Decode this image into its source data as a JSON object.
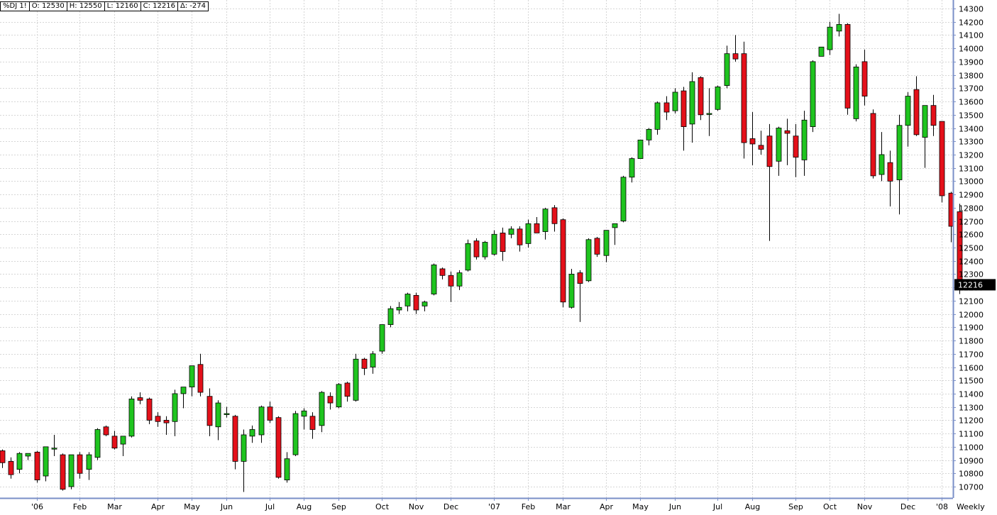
{
  "header": {
    "symbol": "%DJ 1!",
    "open": "O: 12530",
    "high": "H: 12550",
    "low": "L: 12160",
    "close": "C: 12216",
    "change": "Δ: -274"
  },
  "chart_data": {
    "type": "candlestick",
    "interval_label": "Weekly",
    "last_value_label": "12216",
    "ylim": [
      10630,
      14320
    ],
    "yticks": [
      10700,
      10800,
      10900,
      11000,
      11100,
      11200,
      11300,
      11400,
      11500,
      11600,
      11700,
      11800,
      11900,
      12000,
      12100,
      12200,
      12300,
      12400,
      12500,
      12600,
      12700,
      12800,
      12900,
      13000,
      13100,
      13200,
      13300,
      13400,
      13500,
      13600,
      13700,
      13800,
      13900,
      14000,
      14100,
      14200,
      14300
    ],
    "x_labels": [
      {
        "index": 4,
        "label": "'06"
      },
      {
        "index": 9,
        "label": "Feb"
      },
      {
        "index": 13,
        "label": "Mar"
      },
      {
        "index": 18,
        "label": "Apr"
      },
      {
        "index": 22,
        "label": "May"
      },
      {
        "index": 26,
        "label": "Jun"
      },
      {
        "index": 31,
        "label": "Jul"
      },
      {
        "index": 35,
        "label": "Aug"
      },
      {
        "index": 39,
        "label": "Sep"
      },
      {
        "index": 44,
        "label": "Oct"
      },
      {
        "index": 48,
        "label": "Nov"
      },
      {
        "index": 52,
        "label": "Dec"
      },
      {
        "index": 57,
        "label": "'07"
      },
      {
        "index": 61,
        "label": "Feb"
      },
      {
        "index": 65,
        "label": "Mar"
      },
      {
        "index": 70,
        "label": "Apr"
      },
      {
        "index": 74,
        "label": "May"
      },
      {
        "index": 78,
        "label": "Jun"
      },
      {
        "index": 83,
        "label": "Jul"
      },
      {
        "index": 87,
        "label": "Aug"
      },
      {
        "index": 92,
        "label": "Sep"
      },
      {
        "index": 96,
        "label": "Oct"
      },
      {
        "index": 100,
        "label": "Nov"
      },
      {
        "index": 105,
        "label": "Dec"
      },
      {
        "index": 109,
        "label": "'08"
      }
    ],
    "candles": [
      {
        "o": 10970,
        "h": 10980,
        "l": 10840,
        "c": 10880
      },
      {
        "o": 10890,
        "h": 10920,
        "l": 10760,
        "c": 10790
      },
      {
        "o": 10830,
        "h": 10960,
        "l": 10800,
        "c": 10950
      },
      {
        "o": 10930,
        "h": 10950,
        "l": 10900,
        "c": 10950
      },
      {
        "o": 10960,
        "h": 10970,
        "l": 10730,
        "c": 10750
      },
      {
        "o": 10780,
        "h": 11000,
        "l": 10740,
        "c": 11000
      },
      {
        "o": 10990,
        "h": 11090,
        "l": 10930,
        "c": 10990
      },
      {
        "o": 10940,
        "h": 10950,
        "l": 10670,
        "c": 10680
      },
      {
        "o": 10700,
        "h": 10940,
        "l": 10680,
        "c": 10940
      },
      {
        "o": 10940,
        "h": 10960,
        "l": 10760,
        "c": 10800
      },
      {
        "o": 10830,
        "h": 10960,
        "l": 10750,
        "c": 10940
      },
      {
        "o": 10920,
        "h": 11140,
        "l": 10900,
        "c": 11130
      },
      {
        "o": 11150,
        "h": 11160,
        "l": 11080,
        "c": 11090
      },
      {
        "o": 11080,
        "h": 11120,
        "l": 10980,
        "c": 10990
      },
      {
        "o": 11020,
        "h": 11080,
        "l": 10930,
        "c": 11080
      },
      {
        "o": 11080,
        "h": 11380,
        "l": 11070,
        "c": 11360
      },
      {
        "o": 11370,
        "h": 11410,
        "l": 11320,
        "c": 11350
      },
      {
        "o": 11360,
        "h": 11370,
        "l": 11170,
        "c": 11200
      },
      {
        "o": 11230,
        "h": 11260,
        "l": 11150,
        "c": 11190
      },
      {
        "o": 11200,
        "h": 11230,
        "l": 11090,
        "c": 11180
      },
      {
        "o": 11190,
        "h": 11430,
        "l": 11080,
        "c": 11400
      },
      {
        "o": 11400,
        "h": 11440,
        "l": 11290,
        "c": 11450
      },
      {
        "o": 11450,
        "h": 11580,
        "l": 11380,
        "c": 11610
      },
      {
        "o": 11620,
        "h": 11700,
        "l": 11380,
        "c": 11410
      },
      {
        "o": 11380,
        "h": 11440,
        "l": 11080,
        "c": 11160
      },
      {
        "o": 11150,
        "h": 11350,
        "l": 11050,
        "c": 11330
      },
      {
        "o": 11250,
        "h": 11300,
        "l": 11220,
        "c": 11250
      },
      {
        "o": 11230,
        "h": 11240,
        "l": 10830,
        "c": 10890
      },
      {
        "o": 10890,
        "h": 11130,
        "l": 10660,
        "c": 11090
      },
      {
        "o": 11080,
        "h": 11160,
        "l": 11030,
        "c": 11130
      },
      {
        "o": 11090,
        "h": 11310,
        "l": 11030,
        "c": 11300
      },
      {
        "o": 11300,
        "h": 11340,
        "l": 11180,
        "c": 11200
      },
      {
        "o": 11220,
        "h": 11230,
        "l": 10760,
        "c": 10770
      },
      {
        "o": 10750,
        "h": 10960,
        "l": 10730,
        "c": 10910
      },
      {
        "o": 10940,
        "h": 11270,
        "l": 10930,
        "c": 11250
      },
      {
        "o": 11230,
        "h": 11290,
        "l": 11130,
        "c": 11270
      },
      {
        "o": 11230,
        "h": 11260,
        "l": 11060,
        "c": 11130
      },
      {
        "o": 11160,
        "h": 11420,
        "l": 11110,
        "c": 11410
      },
      {
        "o": 11380,
        "h": 11410,
        "l": 11280,
        "c": 11330
      },
      {
        "o": 11300,
        "h": 11480,
        "l": 11290,
        "c": 11470
      },
      {
        "o": 11480,
        "h": 11490,
        "l": 11340,
        "c": 11380
      },
      {
        "o": 11350,
        "h": 11700,
        "l": 11340,
        "c": 11660
      },
      {
        "o": 11660,
        "h": 11670,
        "l": 11540,
        "c": 11590
      },
      {
        "o": 11600,
        "h": 11720,
        "l": 11550,
        "c": 11700
      },
      {
        "o": 11720,
        "h": 11920,
        "l": 11700,
        "c": 11920
      },
      {
        "o": 11920,
        "h": 12060,
        "l": 11900,
        "c": 12040
      },
      {
        "o": 12030,
        "h": 12090,
        "l": 12000,
        "c": 12050
      },
      {
        "o": 12060,
        "h": 12160,
        "l": 12020,
        "c": 12150
      },
      {
        "o": 12140,
        "h": 12160,
        "l": 12000,
        "c": 12030
      },
      {
        "o": 12060,
        "h": 12100,
        "l": 12020,
        "c": 12090
      },
      {
        "o": 12150,
        "h": 12380,
        "l": 12140,
        "c": 12370
      },
      {
        "o": 12340,
        "h": 12350,
        "l": 12260,
        "c": 12290
      },
      {
        "o": 12290,
        "h": 12320,
        "l": 12090,
        "c": 12210
      },
      {
        "o": 12210,
        "h": 12330,
        "l": 12180,
        "c": 12310
      },
      {
        "o": 12330,
        "h": 12560,
        "l": 12320,
        "c": 12530
      },
      {
        "o": 12550,
        "h": 12570,
        "l": 12410,
        "c": 12430
      },
      {
        "o": 12430,
        "h": 12550,
        "l": 12410,
        "c": 12540
      },
      {
        "o": 12450,
        "h": 12630,
        "l": 12440,
        "c": 12600
      },
      {
        "o": 12610,
        "h": 12650,
        "l": 12400,
        "c": 12470
      },
      {
        "o": 12600,
        "h": 12660,
        "l": 12570,
        "c": 12640
      },
      {
        "o": 12640,
        "h": 12660,
        "l": 12470,
        "c": 12520
      },
      {
        "o": 12530,
        "h": 12710,
        "l": 12500,
        "c": 12680
      },
      {
        "o": 12680,
        "h": 12730,
        "l": 12610,
        "c": 12610
      },
      {
        "o": 12620,
        "h": 12800,
        "l": 12560,
        "c": 12790
      },
      {
        "o": 12800,
        "h": 12820,
        "l": 12620,
        "c": 12680
      },
      {
        "o": 12710,
        "h": 12720,
        "l": 12050,
        "c": 12090
      },
      {
        "o": 12050,
        "h": 12340,
        "l": 12040,
        "c": 12300
      },
      {
        "o": 12310,
        "h": 12330,
        "l": 11940,
        "c": 12230
      },
      {
        "o": 12250,
        "h": 12570,
        "l": 12240,
        "c": 12560
      },
      {
        "o": 12570,
        "h": 12580,
        "l": 12430,
        "c": 12450
      },
      {
        "o": 12440,
        "h": 12630,
        "l": 12390,
        "c": 12630
      },
      {
        "o": 12650,
        "h": 12680,
        "l": 12520,
        "c": 12680
      },
      {
        "o": 12700,
        "h": 13040,
        "l": 12690,
        "c": 13030
      },
      {
        "o": 13030,
        "h": 13180,
        "l": 12990,
        "c": 13170
      },
      {
        "o": 13170,
        "h": 13310,
        "l": 13170,
        "c": 13310
      },
      {
        "o": 13310,
        "h": 13400,
        "l": 13270,
        "c": 13390
      },
      {
        "o": 13390,
        "h": 13600,
        "l": 13350,
        "c": 13590
      },
      {
        "o": 13590,
        "h": 13640,
        "l": 13460,
        "c": 13520
      },
      {
        "o": 13530,
        "h": 13700,
        "l": 13510,
        "c": 13670
      },
      {
        "o": 13680,
        "h": 13710,
        "l": 13230,
        "c": 13410
      },
      {
        "o": 13430,
        "h": 13820,
        "l": 13290,
        "c": 13750
      },
      {
        "o": 13780,
        "h": 13790,
        "l": 13460,
        "c": 13500
      },
      {
        "o": 13510,
        "h": 13700,
        "l": 13340,
        "c": 13510
      },
      {
        "o": 13540,
        "h": 13720,
        "l": 13530,
        "c": 13710
      },
      {
        "o": 13720,
        "h": 14020,
        "l": 13700,
        "c": 13960
      },
      {
        "o": 13960,
        "h": 14100,
        "l": 13900,
        "c": 13920
      },
      {
        "o": 13960,
        "h": 14050,
        "l": 13170,
        "c": 13290
      },
      {
        "o": 13320,
        "h": 13520,
        "l": 13120,
        "c": 13280
      },
      {
        "o": 13270,
        "h": 13380,
        "l": 13200,
        "c": 13240
      },
      {
        "o": 13340,
        "h": 13430,
        "l": 12550,
        "c": 13110
      },
      {
        "o": 13150,
        "h": 13410,
        "l": 13040,
        "c": 13400
      },
      {
        "o": 13380,
        "h": 13470,
        "l": 13120,
        "c": 13360
      },
      {
        "o": 13340,
        "h": 13430,
        "l": 13030,
        "c": 13180
      },
      {
        "o": 13160,
        "h": 13530,
        "l": 13040,
        "c": 13460
      },
      {
        "o": 13410,
        "h": 13910,
        "l": 13370,
        "c": 13900
      },
      {
        "o": 13940,
        "h": 14010,
        "l": 13940,
        "c": 14010
      },
      {
        "o": 13990,
        "h": 14200,
        "l": 13950,
        "c": 14160
      },
      {
        "o": 14130,
        "h": 14260,
        "l": 14090,
        "c": 14180
      },
      {
        "o": 14180,
        "h": 14190,
        "l": 13500,
        "c": 13550
      },
      {
        "o": 13470,
        "h": 13880,
        "l": 13450,
        "c": 13860
      },
      {
        "o": 13900,
        "h": 13990,
        "l": 13570,
        "c": 13640
      },
      {
        "o": 13510,
        "h": 13540,
        "l": 13020,
        "c": 13040
      },
      {
        "o": 13050,
        "h": 13370,
        "l": 13000,
        "c": 13200
      },
      {
        "o": 13140,
        "h": 13230,
        "l": 12810,
        "c": 13000
      },
      {
        "o": 13010,
        "h": 13500,
        "l": 12750,
        "c": 13420
      },
      {
        "o": 13420,
        "h": 13670,
        "l": 13260,
        "c": 13640
      },
      {
        "o": 13690,
        "h": 13790,
        "l": 13340,
        "c": 13350
      },
      {
        "o": 13330,
        "h": 13570,
        "l": 13100,
        "c": 13570
      },
      {
        "o": 13570,
        "h": 13650,
        "l": 13340,
        "c": 13420
      },
      {
        "o": 13450,
        "h": 13450,
        "l": 12840,
        "c": 12890
      },
      {
        "o": 12910,
        "h": 12920,
        "l": 12540,
        "c": 12660
      },
      {
        "o": 12770,
        "h": 12830,
        "l": 12150,
        "c": 12220
      }
    ]
  }
}
